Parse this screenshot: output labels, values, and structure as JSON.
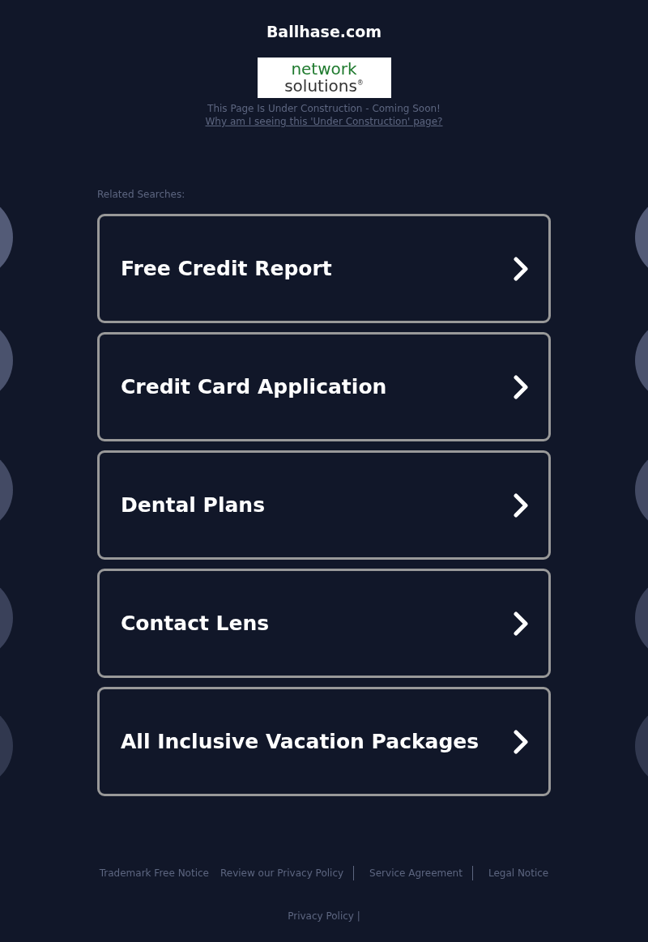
{
  "header": {
    "title": "Ballhase.com",
    "logo": {
      "line_1": "network",
      "line_2": "solutions",
      "mark": "®"
    },
    "notice": "This Page Is Under Construction - Coming Soon!",
    "notice_link": "Why am I seeing this 'Under Construction' page?"
  },
  "related": {
    "label": "Related Searches:",
    "items": [
      {
        "text": "Free Credit Report"
      },
      {
        "text": "Credit Card Application"
      },
      {
        "text": "Dental Plans"
      },
      {
        "text": "Contact Lens"
      },
      {
        "text": "All Inclusive Vacation Packages"
      }
    ]
  },
  "footer": {
    "links": [
      {
        "text": "Trademark Free Notice",
        "divider": false
      },
      {
        "text": "Review our Privacy Policy",
        "divider": true
      },
      {
        "text": "Service Agreement",
        "divider": true
      },
      {
        "text": "Legal Notice",
        "divider": false
      }
    ],
    "bottom_link": "Privacy Policy |"
  }
}
